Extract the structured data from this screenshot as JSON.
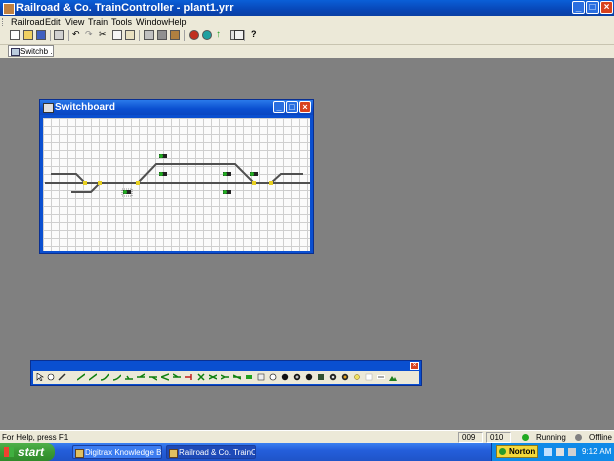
{
  "window": {
    "title": "Railroad & Co. TrainController - plant1.yrr"
  },
  "menu": [
    "Railroad",
    "Edit",
    "View",
    "Train",
    "Tools",
    "Window",
    "Help"
  ],
  "tab": {
    "label": "Switchb ..."
  },
  "switchboard": {
    "title": "Switchboard"
  },
  "status": {
    "help": "For Help, press F1",
    "field1": "009",
    "field2": "010",
    "running": "Running",
    "offline": "Offline"
  },
  "taskbar": {
    "start": "start",
    "tasks": [
      "Digitrax Knowledge B...",
      "Railroad & Co. TrainC..."
    ],
    "norton": "Norton",
    "clock": "9:12 AM"
  },
  "colors": {
    "title_blue": "#0a4fd0",
    "track": "#505050",
    "signal_green": "#22aa22",
    "turnout_yellow": "#e8d020",
    "running_green": "#22aa22",
    "offline_gray": "#808080"
  }
}
